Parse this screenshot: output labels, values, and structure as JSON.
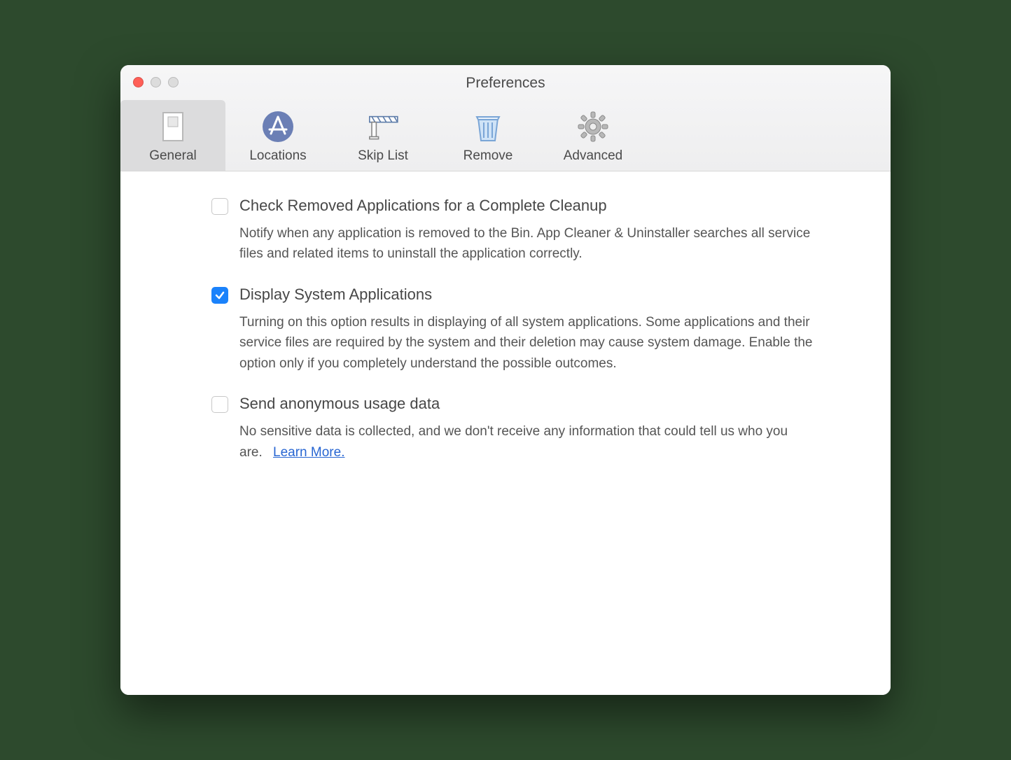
{
  "window": {
    "title": "Preferences"
  },
  "tabs": [
    {
      "label": "General",
      "icon": "switch-icon",
      "active": true
    },
    {
      "label": "Locations",
      "icon": "appstore-icon",
      "active": false
    },
    {
      "label": "Skip List",
      "icon": "barrier-icon",
      "active": false
    },
    {
      "label": "Remove",
      "icon": "trash-icon",
      "active": false
    },
    {
      "label": "Advanced",
      "icon": "gear-icon",
      "active": false
    }
  ],
  "options": [
    {
      "checked": false,
      "title": "Check Removed Applications for a Complete Cleanup",
      "description": "Notify when any application is removed to the Bin. App Cleaner & Uninstaller searches all service files and related items to uninstall the application correctly."
    },
    {
      "checked": true,
      "title": "Display System Applications",
      "description": "Turning on this option results in displaying of all system applications. Some applications and their service files are required by the system and their deletion may cause system damage. Enable the option only if you completely understand the possible outcomes."
    },
    {
      "checked": false,
      "title": "Send anonymous usage data",
      "description": "No sensitive data is collected, and we don't receive any information that could tell us who you are.",
      "link_label": "Learn More."
    }
  ]
}
